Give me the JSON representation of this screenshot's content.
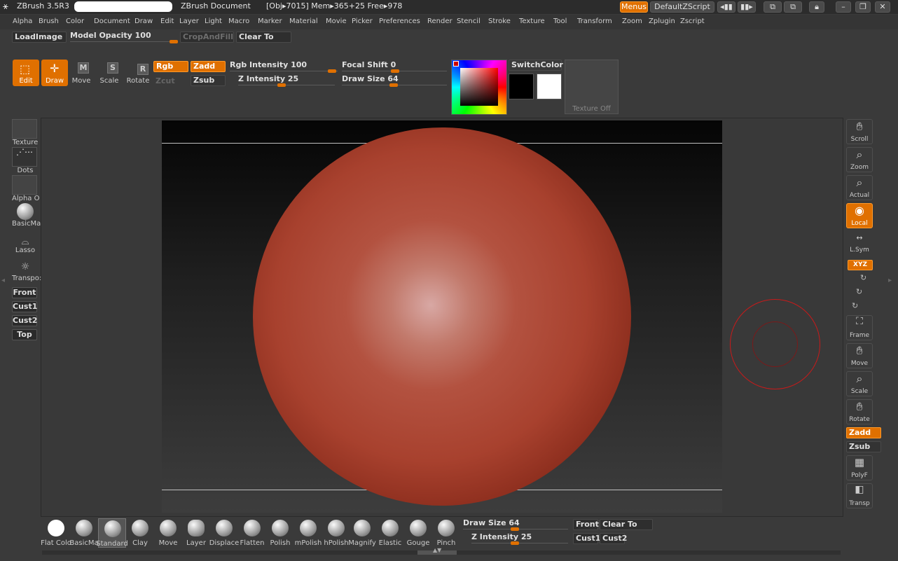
{
  "window": {
    "app_title": "ZBrush 3.5R3",
    "document_title": "ZBrush Document",
    "status": "[Obj▸7015] Mem▸365+25 Free▸978",
    "menus_button": "Menus",
    "script_button": "DefaultZScript"
  },
  "menubar": {
    "items": [
      "Alpha",
      "Brush",
      "Color",
      "Document",
      "Draw",
      "Edit",
      "Layer",
      "Light",
      "Macro",
      "Marker",
      "Material",
      "Movie",
      "Picker",
      "Preferences",
      "Render",
      "Stencil",
      "Stroke",
      "Texture",
      "Tool",
      "Transform",
      "Zoom",
      "Zplugin",
      "Zscript"
    ]
  },
  "toolbar1": {
    "load_image": "LoadImage",
    "model_opacity_label": "Model Opacity",
    "model_opacity_value": "100",
    "model_opacity_fraction": 1.0,
    "crop_and_fill": "CropAndFill",
    "clear_to": "Clear To"
  },
  "toolbar2": {
    "edit": "Edit",
    "draw": "Draw",
    "move": "Move",
    "scale": "Scale",
    "rotate": "Rotate",
    "rgb": "Rgb",
    "zadd": "Zadd",
    "zcut": "Zcut",
    "zsub": "Zsub",
    "rgb_intensity_label": "Rgb Intensity",
    "rgb_intensity_value": "100",
    "z_intensity_label": "Z Intensity",
    "z_intensity_value": "25",
    "focal_shift_label": "Focal Shift",
    "focal_shift_value": "0",
    "draw_size_label": "Draw Size",
    "draw_size_value": "64",
    "switch_color": "SwitchColor",
    "texture_off": "Texture Off",
    "primary_color": "#000000",
    "secondary_color": "#ffffff"
  },
  "left_shelf": {
    "texture": "Texture",
    "dots": "Dots",
    "alpha": "Alpha  O",
    "material": "BasicMa",
    "lasso": "Lasso",
    "transpose": "Transpo:",
    "front": "Front",
    "cust1": "Cust1",
    "cust2": "Cust2",
    "top": "Top"
  },
  "right_shelf": {
    "scroll": "Scroll",
    "zoom": "Zoom",
    "actual": "Actual",
    "local": "Local",
    "lsym": "L.Sym",
    "xyz": "XYZ",
    "frame": "Frame",
    "move": "Move",
    "scale": "Scale",
    "rotate": "Rotate",
    "zadd": "Zadd",
    "zsub": "Zsub",
    "polyf": "PolyF",
    "transp": "Transp"
  },
  "bottom_shelf": {
    "brushes": [
      "Flat Colo",
      "BasicMa",
      "Standard",
      "Clay",
      "Move",
      "Layer",
      "Displace",
      "Flatten",
      "Polish",
      "mPolish",
      "hPolish",
      "Magnify",
      "Elastic",
      "Gouge",
      "Pinch"
    ],
    "draw_size_label": "Draw Size",
    "draw_size_value": "64",
    "z_intensity_label": "Z Intensity",
    "z_intensity_value": "25",
    "front": "Front",
    "clear_to": "Clear To",
    "cust1": "Cust1",
    "cust2": "Cust2"
  },
  "colors": {
    "accent": "#e07000",
    "sphere": "#b4402c"
  }
}
